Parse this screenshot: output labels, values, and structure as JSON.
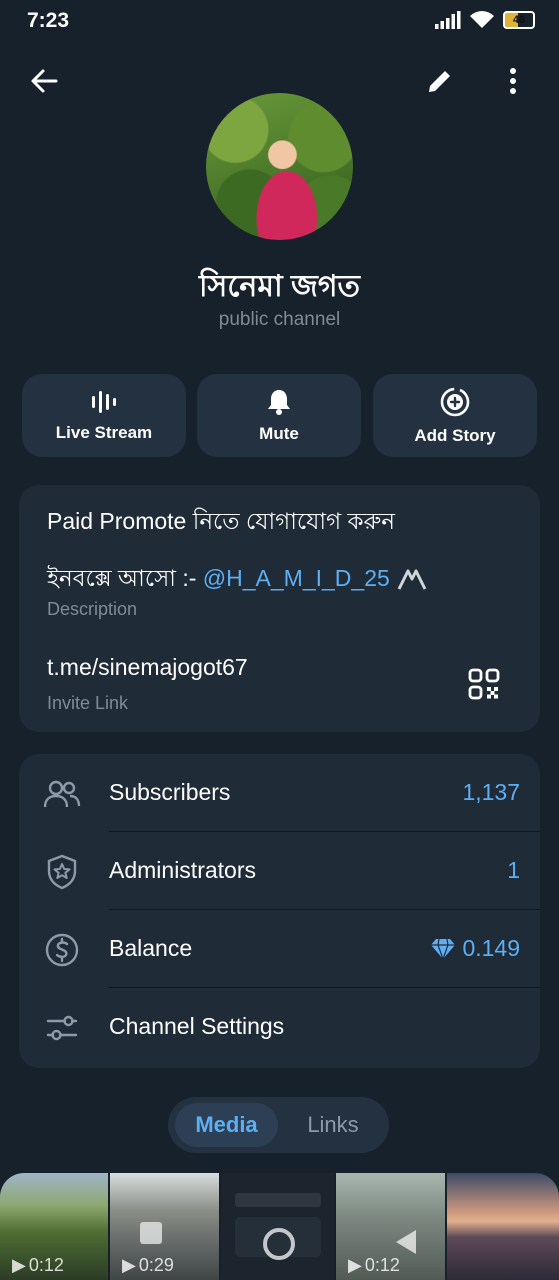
{
  "status": {
    "time": "7:23",
    "battery": "46"
  },
  "channel": {
    "name": "সিনেমা জগত",
    "type": "public channel"
  },
  "actions": [
    {
      "label": "Live Stream",
      "icon": "live-stream-icon"
    },
    {
      "label": "Mute",
      "icon": "bell-icon"
    },
    {
      "label": "Add Story",
      "icon": "add-story-icon"
    }
  ],
  "info": {
    "line1": "Paid Promote নিতে যোগাযোগ করুন",
    "line2_prefix": "ইনবক্সে আসো :- ",
    "line2_mention": "@H_A_M_I_D_25",
    "description_label": "Description",
    "link": "t.me/sinemajogot67",
    "link_label": "Invite Link"
  },
  "rows": [
    {
      "label": "Subscribers",
      "value": "1,137",
      "icon": "people-icon"
    },
    {
      "label": "Administrators",
      "value": "1",
      "icon": "shield-star-icon"
    },
    {
      "label": "Balance",
      "value": "0.149",
      "icon": "dollar-icon"
    },
    {
      "label": "Channel Settings",
      "value": "",
      "icon": "settings-sliders-icon"
    }
  ],
  "tabs": {
    "media": "Media",
    "links": "Links"
  },
  "media": [
    {
      "duration": "0:12"
    },
    {
      "duration": "0:29"
    },
    {
      "duration": ""
    },
    {
      "duration": "0:12"
    },
    {
      "duration": ""
    }
  ],
  "colors": {
    "accent": "#5eaef2",
    "background": "#17212b",
    "card": "#202b38"
  }
}
